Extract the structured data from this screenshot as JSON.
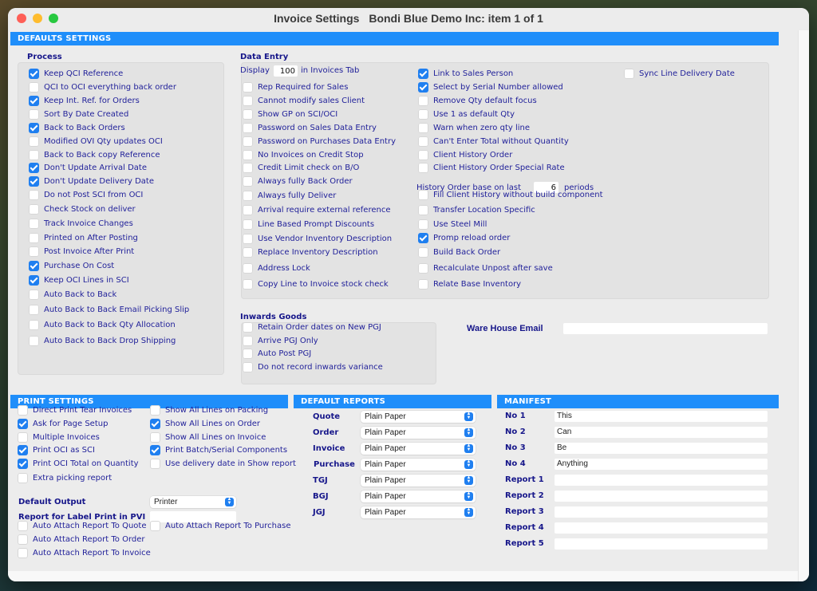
{
  "window": {
    "title": "Invoice Settings",
    "company": "Bondi Blue Demo Inc: item 1  of  1"
  },
  "defaults": {
    "header": "DEFAULTS SETTINGS",
    "process": {
      "title": "Process",
      "items": [
        {
          "label": "Keep QCI Reference",
          "checked": true
        },
        {
          "label": "QCI to OCI everything back order",
          "checked": false
        },
        {
          "label": "Keep Int. Ref. for Orders",
          "checked": true
        },
        {
          "label": "Sort By Date Created",
          "checked": false
        },
        {
          "label": "Back to Back Orders",
          "checked": true
        },
        {
          "label": "Modified OVI Qty updates OCI",
          "checked": false
        },
        {
          "label": "Back to Back copy Reference",
          "checked": false
        },
        {
          "label": "Don't Update Arrival Date",
          "checked": true
        },
        {
          "label": "Don't Update Delivery Date",
          "checked": true
        },
        {
          "label": "Do not Post SCI from OCI",
          "checked": false
        },
        {
          "label": "Check Stock on deliver",
          "checked": false
        },
        {
          "label": "Track Invoice Changes",
          "checked": false
        },
        {
          "label": "Printed on After Posting",
          "checked": false
        },
        {
          "label": "Post Invoice After Print",
          "checked": false
        },
        {
          "label": "Purchase On Cost",
          "checked": true
        },
        {
          "label": "Keep OCI Lines in SCI",
          "checked": true
        },
        {
          "label": "Auto Back to Back",
          "checked": false
        },
        {
          "label": "Auto Back to Back Email Picking Slip",
          "checked": false
        },
        {
          "label": "Auto Back to Back Qty Allocation",
          "checked": false
        },
        {
          "label": "Auto Back to Back Drop Shipping",
          "checked": false
        }
      ]
    },
    "data_entry": {
      "title": "Data Entry",
      "display_prefix": "Display",
      "display_value": "100",
      "display_suffix": "in Invoices Tab",
      "col1": [
        {
          "label": "Rep Required for Sales",
          "checked": false
        },
        {
          "label": "Cannot modify sales Client",
          "checked": false
        },
        {
          "label": "Show GP on SCI/OCI",
          "checked": false
        },
        {
          "label": "Password on Sales Data Entry",
          "checked": false
        },
        {
          "label": "Password on Purchases Data Entry",
          "checked": false
        },
        {
          "label": "No Invoices on Credit Stop",
          "checked": false
        },
        {
          "label": "Credit Limit check on B/O",
          "checked": false
        },
        {
          "label": "Always fully Back Order",
          "checked": false
        },
        {
          "label": "Always fully Deliver",
          "checked": false
        },
        {
          "label": "Arrival require external reference",
          "checked": false
        },
        {
          "label": "Line Based Prompt Discounts",
          "checked": false
        },
        {
          "label": "Use Vendor Inventory Description",
          "checked": false
        },
        {
          "label": "Replace Inventory Description",
          "checked": false
        },
        {
          "label": "Address Lock",
          "checked": false
        },
        {
          "label": "Copy Line to Invoice stock check",
          "checked": false
        }
      ],
      "col2a": [
        {
          "label": "Link to Sales Person",
          "checked": true
        },
        {
          "label": "Select by Serial Number allowed",
          "checked": true
        },
        {
          "label": "Remove Qty default focus",
          "checked": false
        },
        {
          "label": "Use 1 as default Qty",
          "checked": false
        },
        {
          "label": "Warn when zero qty line",
          "checked": false
        },
        {
          "label": "Can't Enter Total without Quantity",
          "checked": false
        },
        {
          "label": "Client History Order",
          "checked": false
        },
        {
          "label": "Client History Order Special Rate",
          "checked": false
        }
      ],
      "history_prefix": "History Order base on last",
      "history_value": "6",
      "history_suffix": "periods",
      "col2b": [
        {
          "label": "Fill Client History without build component",
          "checked": false
        },
        {
          "label": "Transfer Location Specific",
          "checked": false
        },
        {
          "label": "Use Steel Mill",
          "checked": false
        },
        {
          "label": "Promp reload order",
          "checked": true
        },
        {
          "label": "Build Back Order",
          "checked": false
        },
        {
          "label": "Recalculate Unpost after save",
          "checked": false
        },
        {
          "label": "Relate Base Inventory",
          "checked": false
        }
      ],
      "col3": [
        {
          "label": "Sync Line Delivery Date",
          "checked": false
        }
      ]
    },
    "inwards_goods": {
      "title": "Inwards Goods",
      "items": [
        {
          "label": "Retain Order dates on New PGJ",
          "checked": false
        },
        {
          "label": "Arrive PGJ Only",
          "checked": false
        },
        {
          "label": "Auto Post PGJ",
          "checked": false
        },
        {
          "label": "Do not record inwards variance",
          "checked": false
        }
      ]
    },
    "warehouse_email": {
      "label": "Ware House Email",
      "value": ""
    }
  },
  "print_settings": {
    "header": "PRINT SETTINGS",
    "col1": [
      {
        "label": "Direct Print Tear Invoices",
        "checked": false
      },
      {
        "label": "Ask for Page Setup",
        "checked": true
      },
      {
        "label": "Multiple Invoices",
        "checked": false
      },
      {
        "label": "Print OCI as SCI",
        "checked": true
      },
      {
        "label": "Print OCI Total on Quantity",
        "checked": true
      },
      {
        "label": "Extra picking report",
        "checked": false
      }
    ],
    "col2": [
      {
        "label": "Show All Lines on Packing",
        "checked": false
      },
      {
        "label": "Show All Lines on Order",
        "checked": true
      },
      {
        "label": "Show All Lines on Invoice",
        "checked": false
      },
      {
        "label": "Print Batch/Serial Components",
        "checked": true
      },
      {
        "label": "Use delivery date in Show report",
        "checked": false
      }
    ],
    "default_output_label": "Default Output",
    "default_output_value": "Printer",
    "label_print_label": "Report for Label Print in PVI",
    "label_print_value": "",
    "attach": [
      {
        "label": "Auto Attach Report To Quote",
        "checked": false
      },
      {
        "label": "Auto Attach Report To Purchase",
        "checked": false
      },
      {
        "label": "Auto Attach Report To Order",
        "checked": false
      },
      {
        "label": "Auto Attach Report To Invoice",
        "checked": false
      }
    ]
  },
  "default_reports": {
    "header": "DEFAULT REPORTS",
    "rows": [
      {
        "label": "Quote",
        "value": "Plain Paper"
      },
      {
        "label": "Order",
        "value": "Plain Paper"
      },
      {
        "label": "Invoice",
        "value": "Plain Paper"
      },
      {
        "label": "Purchase",
        "value": "Plain Paper"
      },
      {
        "label": "TGJ",
        "value": "Plain Paper"
      },
      {
        "label": "BGJ",
        "value": "Plain Paper"
      },
      {
        "label": "JGJ",
        "value": "Plain Paper"
      }
    ]
  },
  "manifest": {
    "header": "MANIFEST",
    "rows": [
      {
        "label": "No 1",
        "value": "This"
      },
      {
        "label": "No 2",
        "value": "Can"
      },
      {
        "label": "No 3",
        "value": "Be"
      },
      {
        "label": "No 4",
        "value": "Anything"
      },
      {
        "label": "Report 1",
        "value": ""
      },
      {
        "label": "Report 2",
        "value": ""
      },
      {
        "label": "Report 3",
        "value": ""
      },
      {
        "label": "Report 4",
        "value": ""
      },
      {
        "label": "Report 5",
        "value": ""
      }
    ]
  }
}
